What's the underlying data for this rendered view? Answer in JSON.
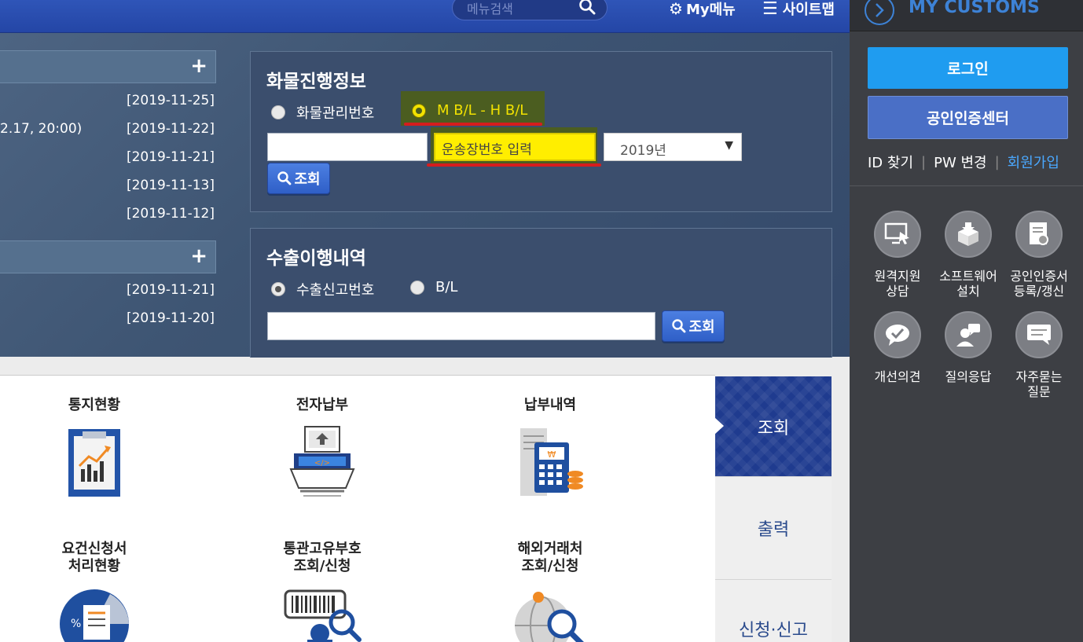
{
  "topbar": {
    "search_placeholder": "메뉴검색",
    "mymenu_label": "My메뉴",
    "sitemap_label": "사이트맵"
  },
  "notices": {
    "group1": [
      {
        "title": "",
        "date": "[2019-11-25]"
      },
      {
        "title": "2.17, 20:00)",
        "date": "[2019-11-22]"
      },
      {
        "title": "",
        "date": "[2019-11-21]"
      },
      {
        "title": "",
        "date": "[2019-11-13]"
      },
      {
        "title": "",
        "date": "[2019-11-12]"
      }
    ],
    "group2": [
      {
        "title": "",
        "date": "[2019-11-21]"
      },
      {
        "title": "",
        "date": "[2019-11-20]"
      }
    ]
  },
  "cargo": {
    "title": "화물진행정보",
    "radio1": "화물관리번호",
    "radio2": "M B/L - H B/L",
    "waybill_placeholder": "운송장번호 입력",
    "year": "2019년",
    "query_label": "조회"
  },
  "export": {
    "title": "수출이행내역",
    "radio1": "수출신고번호",
    "radio2": "B/L",
    "query_label": "조회"
  },
  "services": [
    {
      "label": "통지현황"
    },
    {
      "label": "전자납부"
    },
    {
      "label": "납부내역"
    },
    {
      "label1": "요건신청서",
      "label2": "처리현황"
    },
    {
      "label1": "통관고유부호",
      "label2": "조회/신청"
    },
    {
      "label1": "해외거래처",
      "label2": "조회/신청"
    }
  ],
  "tabs": [
    "조회",
    "출력",
    "신청·신고"
  ],
  "sidebar": {
    "title": "MY CUSTOMS",
    "login": "로그인",
    "cert_center": "공인인증센터",
    "find_id": "ID 찾기",
    "change_pw": "PW 변경",
    "join": "회원가입",
    "items": [
      {
        "line1": "원격지원",
        "line2": "상담"
      },
      {
        "line1": "소프트웨어",
        "line2": "설치"
      },
      {
        "line1": "공인인증서",
        "line2": "등록/갱신"
      },
      {
        "line1": "개선의견",
        "line2": ""
      },
      {
        "line1": "질의응답",
        "line2": ""
      },
      {
        "line1": "자주묻는",
        "line2": "질문"
      }
    ]
  }
}
